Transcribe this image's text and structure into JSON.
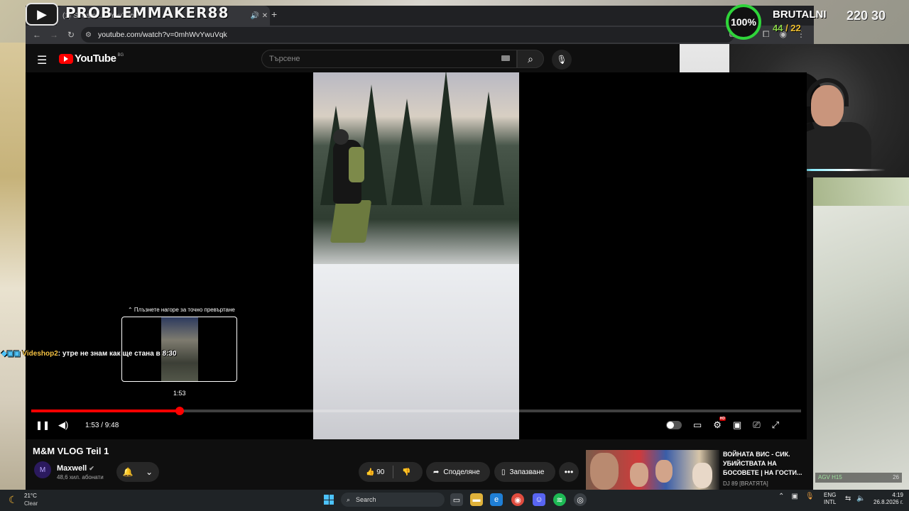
{
  "browser": {
    "tab_title": "(1) Stream ...  - YouTube",
    "url": "youtube.com/watch?v=0mhWvYwuVqk",
    "new_tab_label": "+"
  },
  "overlay": {
    "streamer_name": "PROBLEMMAKER88",
    "percent": "100%",
    "brutal_title": "BRUTALNI",
    "brutal_score_a": "44",
    "brutal_score_b": " / 22",
    "counter": "220 30",
    "hud_agv_label": "AGV H15",
    "hud_agv_value": "26"
  },
  "youtube": {
    "logo_text": "YouTube",
    "region": "BG",
    "search_placeholder": "Търсене"
  },
  "player": {
    "seek_hint": "⌃ Плъзнете нагоре за точно превъртане",
    "preview_time": "1:53",
    "time_display": "1:53 / 9:48",
    "progress": 0.193,
    "chat_user": "Videshop2",
    "chat_text": ": утре не знам как ще стана в 8:30"
  },
  "video": {
    "title": "M&M VLOG Teil 1",
    "channel": "Maxwell",
    "subscribers": "48,6 хил. абонати",
    "likes": "90",
    "share_label": "Споделяне",
    "save_label": "Запазване"
  },
  "recommendation": {
    "title": "ВОЙНАТА ВИС - СИК. УБИЙСТВАТА НА БОСОВЕТЕ | НА ГОСТИ...",
    "channel": "DJ 89 [BRATЯTA]"
  },
  "taskbar": {
    "temp": "21°C",
    "condition": "Clear",
    "search_label": "Search",
    "lang_top": "ENG",
    "lang_bottom": "INTL",
    "time": "4:19",
    "date": "26.8.2026 г."
  },
  "colors": {
    "accent": "#ff0000",
    "bg": "#0f0f0f",
    "hud_green": "#2fd43a"
  }
}
